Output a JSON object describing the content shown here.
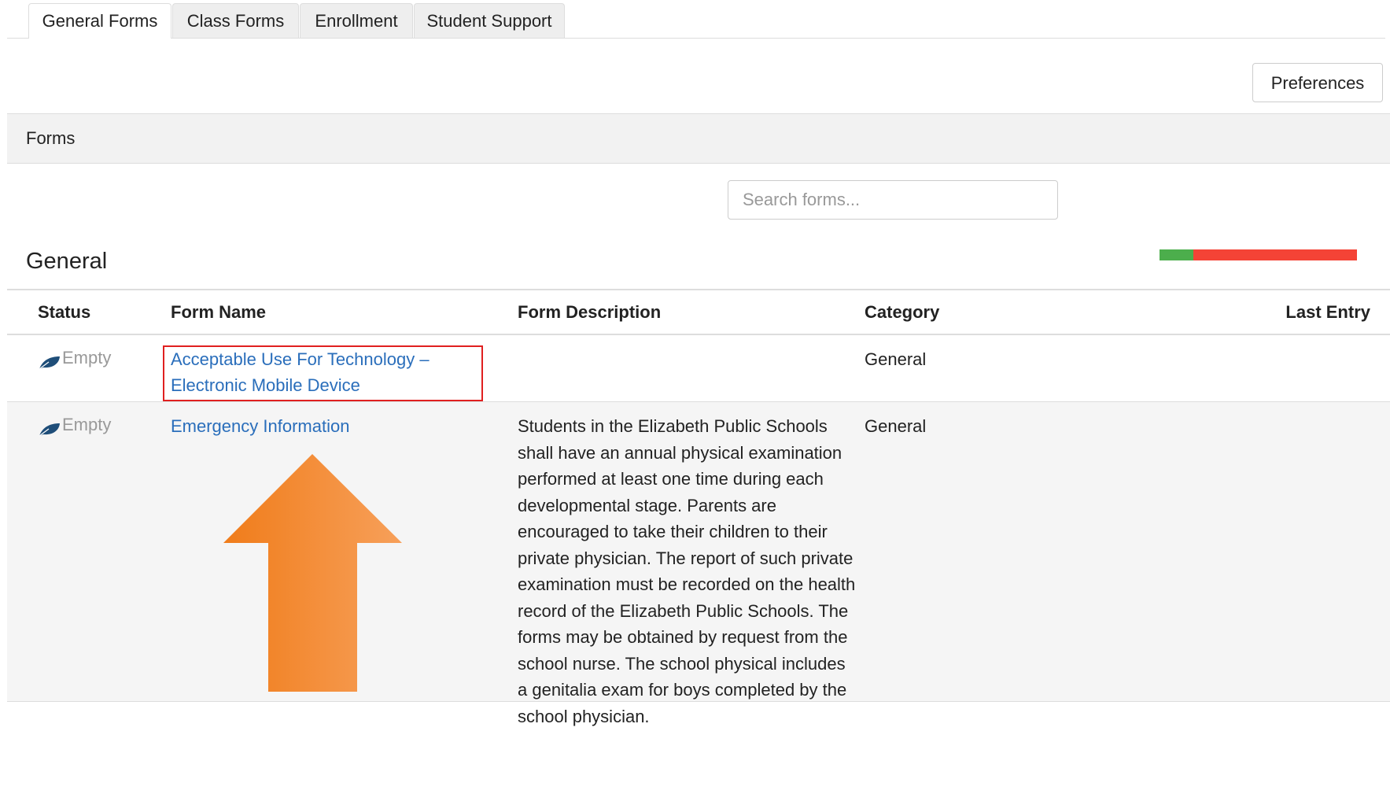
{
  "tabs": [
    {
      "label": "General Forms",
      "active": true
    },
    {
      "label": "Class Forms",
      "active": false
    },
    {
      "label": "Enrollment",
      "active": false
    },
    {
      "label": "Student Support",
      "active": false
    }
  ],
  "toolbar": {
    "preferences_label": "Preferences"
  },
  "panel": {
    "title": "Forms"
  },
  "search": {
    "placeholder": "Search forms...",
    "value": ""
  },
  "section": {
    "title": "General",
    "progress_complete_fraction": 0.17
  },
  "table": {
    "headers": {
      "status": "Status",
      "form_name": "Form Name",
      "form_description": "Form Description",
      "category": "Category",
      "last_entry": "Last Entry"
    },
    "rows": [
      {
        "status": "Empty",
        "form_name": "Acceptable Use For Technology – Electronic Mobile Device",
        "form_description": "",
        "category": "General",
        "last_entry": "",
        "highlighted": true
      },
      {
        "status": "Empty",
        "form_name": "Emergency Information",
        "form_description": "Students in the Elizabeth Public Schools shall have an annual physical examination performed at least one time during each developmental stage. Parents are encouraged to take their children to their private physician. The report of such private examination must be recorded on the health record of the Elizabeth Public Schools. The forms may be obtained by request from the school nurse. The school physical includes a genitalia exam for boys completed by the school physician.",
        "category": "General",
        "last_entry": "",
        "highlighted": false
      }
    ]
  },
  "colors": {
    "link": "#2a6ebb",
    "progress_complete": "#4cae4c",
    "progress_remaining": "#f44336",
    "highlight_box": "#e02020",
    "annotation_arrow": "#f4892a",
    "status_icon": "#1f4e79"
  },
  "icons": {
    "status": "leaf-icon",
    "annotation": "up-arrow-annotation"
  }
}
